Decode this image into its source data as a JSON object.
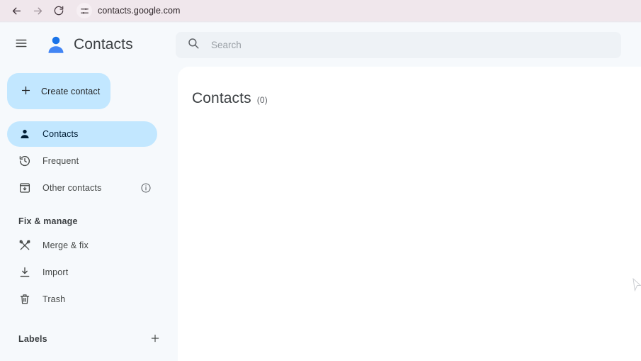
{
  "browser": {
    "back_icon": "arrow-left-icon",
    "forward_icon": "arrow-right-icon",
    "reload_icon": "reload-icon",
    "site_settings_icon": "tune-sliders-icon",
    "url": "contacts.google.com"
  },
  "header": {
    "menu_icon": "hamburger-menu-icon",
    "logo_icon": "contacts-person-logo-icon",
    "title": "Contacts",
    "search": {
      "icon": "search-icon",
      "placeholder": "Search",
      "value": ""
    }
  },
  "sidebar": {
    "create": {
      "icon": "plus-icon",
      "label": "Create contact"
    },
    "nav": [
      {
        "id": "contacts",
        "icon": "person-icon",
        "label": "Contacts",
        "active": true,
        "trailing": null
      },
      {
        "id": "frequent",
        "icon": "history-clock-icon",
        "label": "Frequent",
        "active": false,
        "trailing": null
      },
      {
        "id": "other-contacts",
        "icon": "box-download-icon",
        "label": "Other contacts",
        "active": false,
        "trailing": "info-circle-icon"
      }
    ],
    "fix_manage": {
      "title": "Fix & manage",
      "items": [
        {
          "id": "merge-fix",
          "icon": "merge-tools-icon",
          "label": "Merge & fix"
        },
        {
          "id": "import",
          "icon": "download-icon",
          "label": "Import"
        },
        {
          "id": "trash",
          "icon": "trash-bin-icon",
          "label": "Trash"
        }
      ]
    },
    "labels": {
      "title": "Labels",
      "add_icon": "plus-icon"
    }
  },
  "main": {
    "title": "Contacts",
    "count": "(0)"
  },
  "colors": {
    "accent": "#c2e7ff",
    "brand_blue": "#1a73e8",
    "sidebar_bg": "#f6f9fc",
    "panel_bg": "#ffffff",
    "browser_bar": "#f0e7ec",
    "text_primary": "#3c4043",
    "text_secondary": "#444746"
  }
}
